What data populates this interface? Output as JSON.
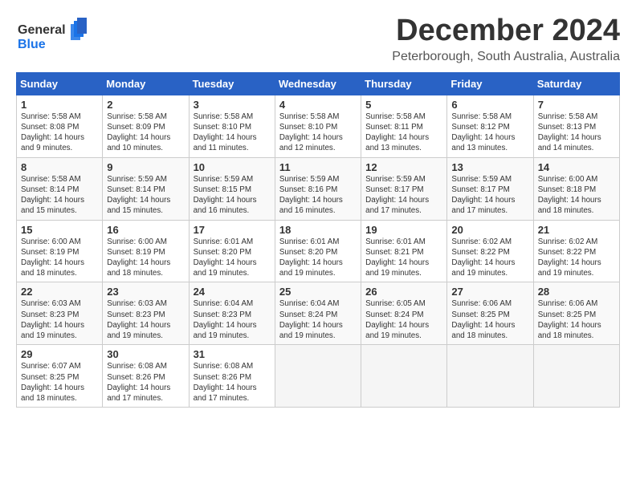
{
  "logo": {
    "line1": "General",
    "line2": "Blue"
  },
  "title": "December 2024",
  "subtitle": "Peterborough, South Australia, Australia",
  "header": {
    "colors": {
      "bg": "#2962c5"
    }
  },
  "weekdays": [
    "Sunday",
    "Monday",
    "Tuesday",
    "Wednesday",
    "Thursday",
    "Friday",
    "Saturday"
  ],
  "weeks": [
    [
      {
        "day": "1",
        "info": "Sunrise: 5:58 AM\nSunset: 8:08 PM\nDaylight: 14 hours\nand 9 minutes."
      },
      {
        "day": "2",
        "info": "Sunrise: 5:58 AM\nSunset: 8:09 PM\nDaylight: 14 hours\nand 10 minutes."
      },
      {
        "day": "3",
        "info": "Sunrise: 5:58 AM\nSunset: 8:10 PM\nDaylight: 14 hours\nand 11 minutes."
      },
      {
        "day": "4",
        "info": "Sunrise: 5:58 AM\nSunset: 8:10 PM\nDaylight: 14 hours\nand 12 minutes."
      },
      {
        "day": "5",
        "info": "Sunrise: 5:58 AM\nSunset: 8:11 PM\nDaylight: 14 hours\nand 13 minutes."
      },
      {
        "day": "6",
        "info": "Sunrise: 5:58 AM\nSunset: 8:12 PM\nDaylight: 14 hours\nand 13 minutes."
      },
      {
        "day": "7",
        "info": "Sunrise: 5:58 AM\nSunset: 8:13 PM\nDaylight: 14 hours\nand 14 minutes."
      }
    ],
    [
      {
        "day": "8",
        "info": "Sunrise: 5:58 AM\nSunset: 8:14 PM\nDaylight: 14 hours\nand 15 minutes."
      },
      {
        "day": "9",
        "info": "Sunrise: 5:59 AM\nSunset: 8:14 PM\nDaylight: 14 hours\nand 15 minutes."
      },
      {
        "day": "10",
        "info": "Sunrise: 5:59 AM\nSunset: 8:15 PM\nDaylight: 14 hours\nand 16 minutes."
      },
      {
        "day": "11",
        "info": "Sunrise: 5:59 AM\nSunset: 8:16 PM\nDaylight: 14 hours\nand 16 minutes."
      },
      {
        "day": "12",
        "info": "Sunrise: 5:59 AM\nSunset: 8:17 PM\nDaylight: 14 hours\nand 17 minutes."
      },
      {
        "day": "13",
        "info": "Sunrise: 5:59 AM\nSunset: 8:17 PM\nDaylight: 14 hours\nand 17 minutes."
      },
      {
        "day": "14",
        "info": "Sunrise: 6:00 AM\nSunset: 8:18 PM\nDaylight: 14 hours\nand 18 minutes."
      }
    ],
    [
      {
        "day": "15",
        "info": "Sunrise: 6:00 AM\nSunset: 8:19 PM\nDaylight: 14 hours\nand 18 minutes."
      },
      {
        "day": "16",
        "info": "Sunrise: 6:00 AM\nSunset: 8:19 PM\nDaylight: 14 hours\nand 18 minutes."
      },
      {
        "day": "17",
        "info": "Sunrise: 6:01 AM\nSunset: 8:20 PM\nDaylight: 14 hours\nand 19 minutes."
      },
      {
        "day": "18",
        "info": "Sunrise: 6:01 AM\nSunset: 8:20 PM\nDaylight: 14 hours\nand 19 minutes."
      },
      {
        "day": "19",
        "info": "Sunrise: 6:01 AM\nSunset: 8:21 PM\nDaylight: 14 hours\nand 19 minutes."
      },
      {
        "day": "20",
        "info": "Sunrise: 6:02 AM\nSunset: 8:22 PM\nDaylight: 14 hours\nand 19 minutes."
      },
      {
        "day": "21",
        "info": "Sunrise: 6:02 AM\nSunset: 8:22 PM\nDaylight: 14 hours\nand 19 minutes."
      }
    ],
    [
      {
        "day": "22",
        "info": "Sunrise: 6:03 AM\nSunset: 8:23 PM\nDaylight: 14 hours\nand 19 minutes."
      },
      {
        "day": "23",
        "info": "Sunrise: 6:03 AM\nSunset: 8:23 PM\nDaylight: 14 hours\nand 19 minutes."
      },
      {
        "day": "24",
        "info": "Sunrise: 6:04 AM\nSunset: 8:23 PM\nDaylight: 14 hours\nand 19 minutes."
      },
      {
        "day": "25",
        "info": "Sunrise: 6:04 AM\nSunset: 8:24 PM\nDaylight: 14 hours\nand 19 minutes."
      },
      {
        "day": "26",
        "info": "Sunrise: 6:05 AM\nSunset: 8:24 PM\nDaylight: 14 hours\nand 19 minutes."
      },
      {
        "day": "27",
        "info": "Sunrise: 6:06 AM\nSunset: 8:25 PM\nDaylight: 14 hours\nand 18 minutes."
      },
      {
        "day": "28",
        "info": "Sunrise: 6:06 AM\nSunset: 8:25 PM\nDaylight: 14 hours\nand 18 minutes."
      }
    ],
    [
      {
        "day": "29",
        "info": "Sunrise: 6:07 AM\nSunset: 8:25 PM\nDaylight: 14 hours\nand 18 minutes."
      },
      {
        "day": "30",
        "info": "Sunrise: 6:08 AM\nSunset: 8:26 PM\nDaylight: 14 hours\nand 17 minutes."
      },
      {
        "day": "31",
        "info": "Sunrise: 6:08 AM\nSunset: 8:26 PM\nDaylight: 14 hours\nand 17 minutes."
      },
      {
        "day": "",
        "info": ""
      },
      {
        "day": "",
        "info": ""
      },
      {
        "day": "",
        "info": ""
      },
      {
        "day": "",
        "info": ""
      }
    ]
  ]
}
